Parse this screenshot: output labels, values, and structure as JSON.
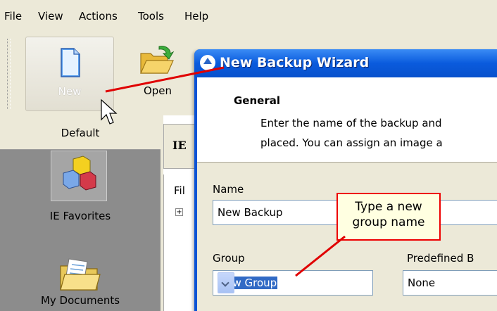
{
  "menu": [
    "File",
    "View",
    "Actions",
    "Tools",
    "Help"
  ],
  "toolbar": {
    "new_label": "New",
    "open_label": "Open"
  },
  "sidebar": {
    "tab_label": "Default",
    "items": [
      {
        "label": "IE Favorites",
        "icon": "blocks-icon"
      },
      {
        "label": "My Documents",
        "icon": "folder-icon"
      }
    ]
  },
  "main": {
    "header": "IE",
    "column": "Fil"
  },
  "wizard": {
    "title": "New Backup Wizard",
    "section_title": "General",
    "section_line1": "Enter the name of the backup and",
    "section_line2": "placed. You can assign an image a",
    "name_label": "Name",
    "name_value": "New Backup",
    "group_label": "Group",
    "group_value": "New Group",
    "predef_label": "Predefined B",
    "predef_value": "None"
  },
  "callout": {
    "line1": "Type a new",
    "line2": "group name"
  },
  "colors": {
    "callout_border": "#e00000",
    "title_bar": "#0a5bdd",
    "selection": "#316ac5"
  }
}
